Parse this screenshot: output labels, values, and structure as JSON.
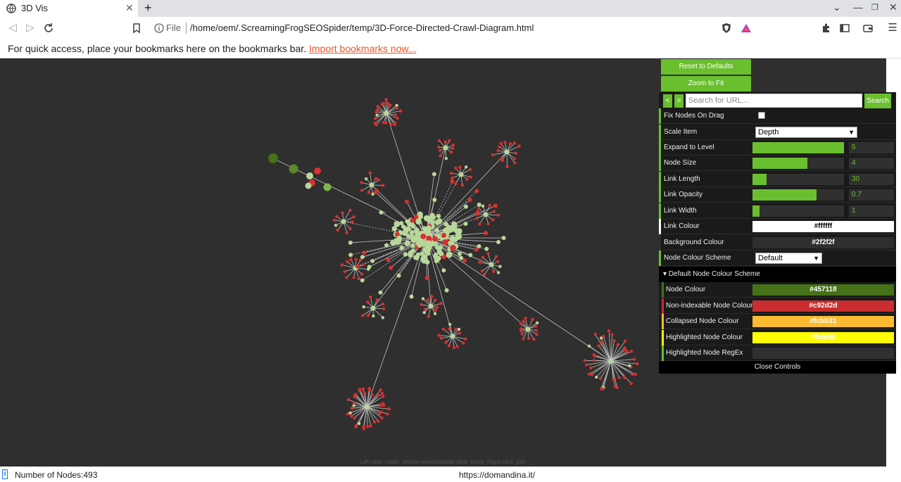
{
  "browser": {
    "tab_title": "3D Vis",
    "new_tab": "+",
    "address_scheme": "File",
    "address_url": "/home/oem/.ScreamingFrogSEOSpider/temp/3D-Force-Directed-Crawl-Diagram.html",
    "bookmarks_prompt": "For quick access, place your bookmarks here on the bookmarks bar.",
    "bookmarks_link": "Import bookmarks now..."
  },
  "controls": {
    "reset_label": "Reset to Defaults",
    "zoom_label": "Zoom to Fit",
    "prev_label": "<",
    "next_label": ">",
    "search_placeholder": "Search for URL...",
    "search_label": "Search",
    "fix_nodes_label": "Fix Nodes On Drag",
    "fix_nodes_checked": false,
    "scale_item_label": "Scale Item",
    "scale_item_value": "Depth",
    "expand_label": "Expand to Level",
    "expand_value": "5",
    "expand_fraction": 1.0,
    "node_size_label": "Node Size",
    "node_size_value": "4",
    "node_size_fraction": 0.6,
    "link_length_label": "Link Length",
    "link_length_value": "30",
    "link_length_fraction": 0.15,
    "link_opacity_label": "Link Opacity",
    "link_opacity_value": "0.7",
    "link_opacity_fraction": 0.7,
    "link_width_label": "Link Width",
    "link_width_value": "1",
    "link_width_fraction": 0.08,
    "link_colour_label": "Link Colour",
    "link_colour_value": "#ffffff",
    "bg_colour_label": "Background Colour",
    "bg_colour_value": "#2f2f2f",
    "scheme_label": "Node Colour Scheme",
    "scheme_value": "Default",
    "scheme_folder_label": "Default Node Colour Scheme",
    "node_colour_label": "Node Colour",
    "node_colour_value": "#457118",
    "nonindex_label": "Non-indexable Node Colour",
    "nonindex_value": "#c92d2d",
    "collapsed_label": "Collapsed Node Colour",
    "collapsed_value": "#fcbb31",
    "highlighted_label": "Highlighted Node Colour",
    "highlighted_value": "#fefe00",
    "regex_label": "Highlighted Node RegEx",
    "regex_value": "",
    "close_label": "Close Controls"
  },
  "viewport": {
    "hint": "Left-click: rotate, Mouse-wheel/middle-click: zoom, Right-click: pan"
  },
  "status": {
    "nodes": "Number of Nodes:493",
    "url": "https://domandina.it/"
  },
  "colors": {
    "accent": "#6abf2e",
    "node_light": "#b8d89a",
    "node_red": "#d93030",
    "node_dark": "#457118"
  }
}
